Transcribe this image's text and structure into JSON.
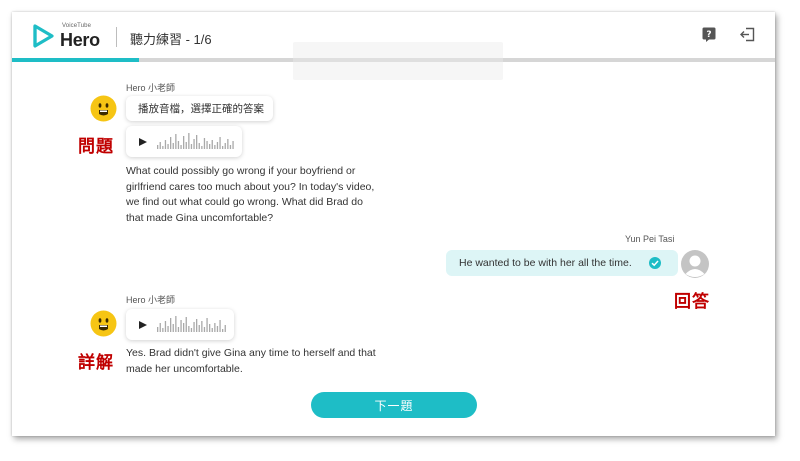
{
  "header": {
    "logo_sub": "VoiceTube",
    "logo_main": "Hero",
    "title": "聽力練習 - 1/6",
    "progress": 0.167
  },
  "colors": {
    "accent": "#1ebdc6",
    "annotation": "#c00000",
    "answer_bg": "#ddf5f6"
  },
  "icons": {
    "help": "help-icon",
    "exit": "exit-icon",
    "play": "play-icon",
    "check": "check-circle-icon",
    "avatar": "user-avatar-icon"
  },
  "question": {
    "sender": "Hero 小老師",
    "instruction": "播放音檔，選擇正確的答案",
    "annotation": "問題",
    "lines": [
      "What could possibly go wrong if your boyfriend or",
      "girlfriend cares too much about you? In today's video,",
      "we find out what could go wrong. What did Brad do",
      "that made Gina uncomfortable?"
    ]
  },
  "answer": {
    "sender": "Yun Pei Tasi",
    "text": "He wanted to be with her all the time.",
    "annotation": "回答"
  },
  "explanation": {
    "sender": "Hero 小老師",
    "annotation": "詳解",
    "lines": [
      "Yes. Brad didn't give Gina any time to herself and that",
      "made her uncomfortable."
    ]
  },
  "footer": {
    "next_label": "下一題"
  }
}
